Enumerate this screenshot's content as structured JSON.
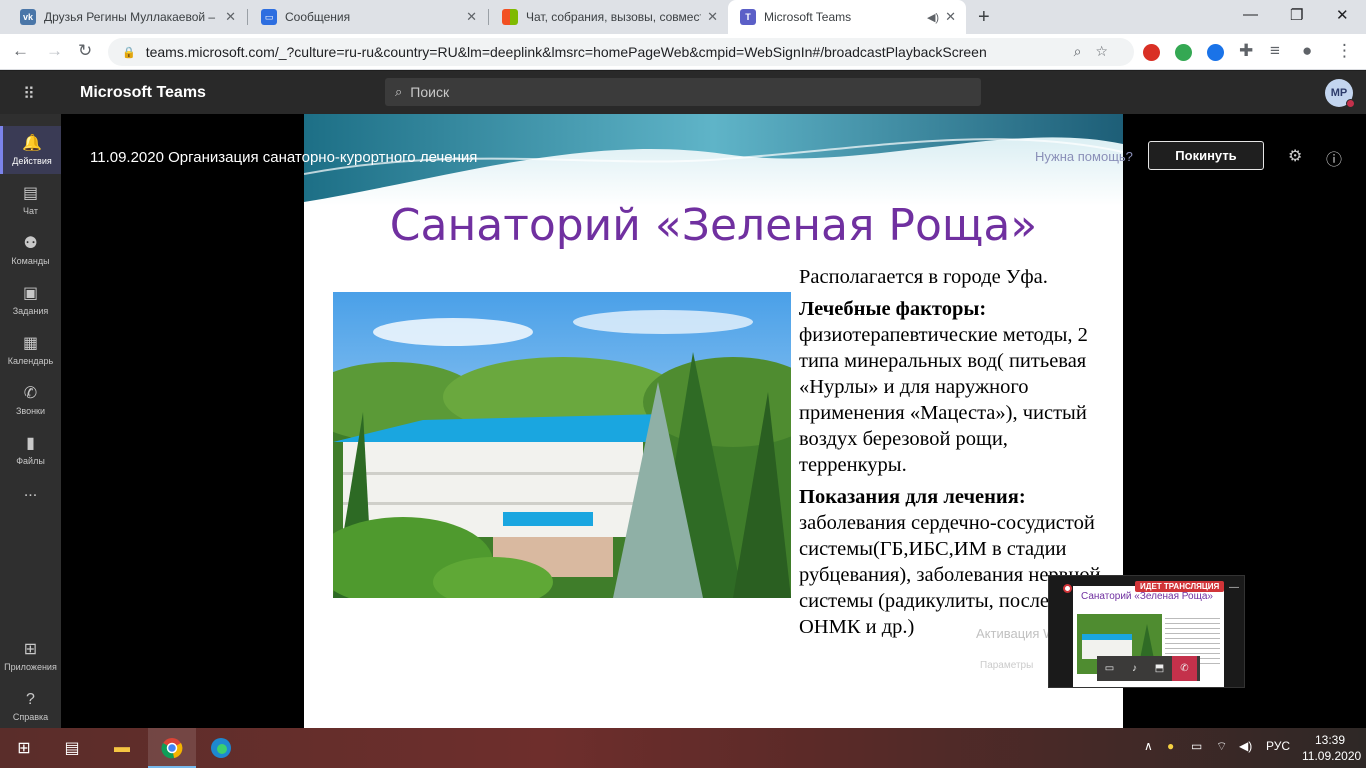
{
  "browser": {
    "tabs": [
      {
        "title": "Друзья Регины Муллакаевой –",
        "favicon": "vk-icon",
        "color": "#4a76a8",
        "active": false
      },
      {
        "title": "Сообщения",
        "favicon": "chat-bubble-icon",
        "color": "#2d6ee0",
        "active": false
      },
      {
        "title": "Чат, собрания, вызовы, совмест",
        "favicon": "microsoft-logo-icon",
        "color": "#f25022",
        "active": false
      },
      {
        "title": "Microsoft Teams",
        "favicon": "teams-icon",
        "color": "#5b5fc7",
        "active": true
      }
    ],
    "url": "teams.microsoft.com/_?culture=ru-ru&country=RU&lm=deeplink&lmsrc=homePageWeb&cmpid=WebSignIn#/broadcastPlaybackScreen"
  },
  "teams": {
    "app_name": "Microsoft Teams",
    "search_placeholder": "Поиск",
    "avatar_initials": "MP",
    "rail": [
      {
        "label": "Действия",
        "icon": "bell-icon",
        "active": true
      },
      {
        "label": "Чат",
        "icon": "chat-icon",
        "active": false
      },
      {
        "label": "Команды",
        "icon": "teams-icon",
        "active": false
      },
      {
        "label": "Задания",
        "icon": "assignments-icon",
        "active": false
      },
      {
        "label": "Календарь",
        "icon": "calendar-icon",
        "active": false
      },
      {
        "label": "Звонки",
        "icon": "phone-icon",
        "active": false
      },
      {
        "label": "Файлы",
        "icon": "files-icon",
        "active": false
      },
      {
        "label": "...",
        "icon": "more-icon",
        "active": false
      },
      {
        "label": "Приложения",
        "icon": "apps-icon",
        "active": false
      },
      {
        "label": "Справка",
        "icon": "help-icon",
        "active": false
      }
    ]
  },
  "meeting": {
    "title": "11.09.2020 Организация санаторно-курортного лечения",
    "help_link": "Нужна помощь?",
    "leave_label": "Покинуть"
  },
  "slide": {
    "title": "Санаторий «Зеленая Роща»",
    "paragraphs": [
      {
        "text": "Располагается в городе Уфа.",
        "bold": false
      },
      {
        "text": "Лечебные факторы:",
        "bold": true
      },
      {
        "text": "физиотерапевтические методы, 2 типа минеральных вод( питьевая «Нурлы» и для наружного применения «Мацеста»), чистый воздух березовой рощи, терренкуры.",
        "bold": false
      },
      {
        "text": "Показания для лечения:",
        "bold": true
      },
      {
        "text": "заболевания сердечно-сосудистой системы(ГБ,ИБС,ИМ в стадии рубцевания), заболевания нервной системы (радикулиты, последствия ОНМК и др.)",
        "bold": false
      }
    ]
  },
  "preview": {
    "mini_title": "Санаторий «Зеленая Роща»",
    "live_badge": "ИДЕТ ТРАНСЛЯЦИЯ"
  },
  "watermark": {
    "line1": "Активация Windows",
    "line2": "Параметры"
  },
  "taskbar": {
    "language": "РУС",
    "time": "13:39",
    "date": "11.09.2020"
  }
}
